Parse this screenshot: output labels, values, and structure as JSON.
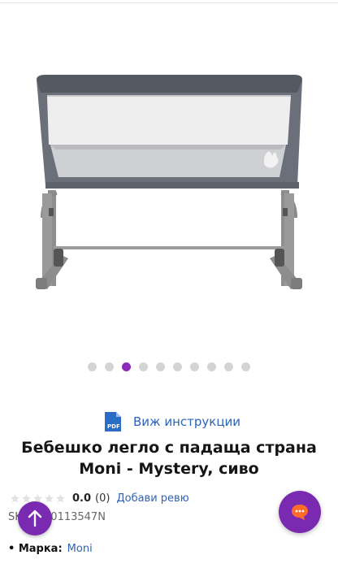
{
  "gallery": {
    "dot_count": 10,
    "active_index": 2,
    "image_alt_icon": "baby-crib-photo"
  },
  "instructions": {
    "icon": "pdf-icon",
    "icon_text": "PDF",
    "label": "Виж инструкции"
  },
  "product": {
    "title": "Бебешко легло с падаща страна Moni - Mystery, сиво",
    "rating": {
      "stars_filled": 0,
      "stars_total": 5,
      "value": "0.0",
      "count": "(0)",
      "add_review_label": "Добави ревю"
    },
    "sku": "SKU: BB0113547N",
    "brand": {
      "key": "• Марка:",
      "value": "Moni"
    }
  },
  "floating": {
    "scroll_top_icon": "arrow-up-icon",
    "chat_icon": "chat-bubble-icon"
  },
  "colors": {
    "accent": "#7a2ab0",
    "active_dot": "#8a2bb9",
    "link": "#2e63b8",
    "pdf_blue": "#2b6cc4"
  }
}
